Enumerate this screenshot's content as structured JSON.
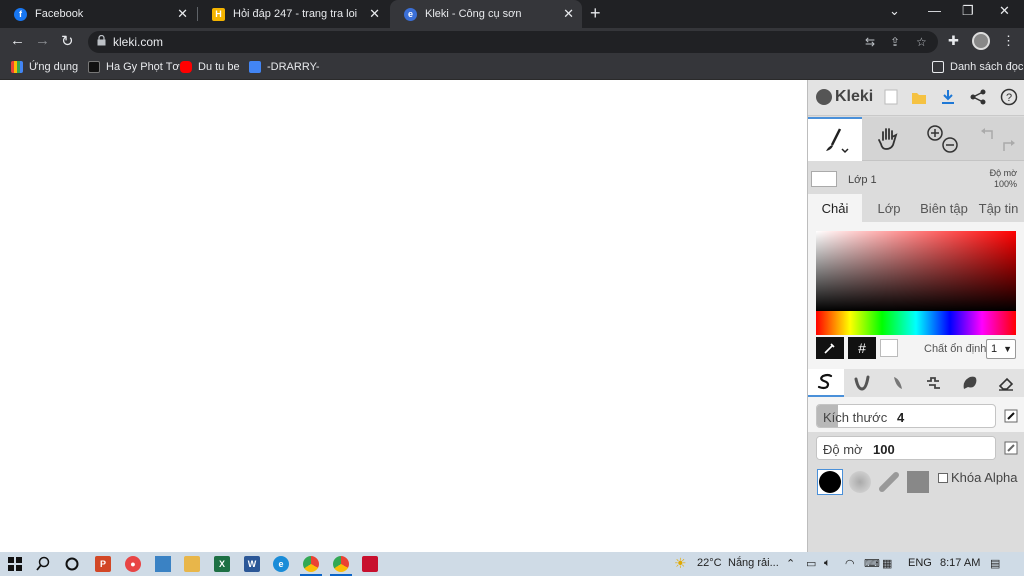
{
  "browser": {
    "tabs": [
      {
        "title": "Facebook",
        "favicon": "facebook-icon",
        "color": "#1877f2"
      },
      {
        "title": "Hỏi đáp 247 - trang tra loi",
        "favicon": "hoidap-icon",
        "color": "#f4b400"
      },
      {
        "title": "Kleki - Công cụ sơn",
        "favicon": "kleki-icon",
        "color": "#3b6fd6"
      }
    ],
    "url": "kleki.com",
    "bookmarks": [
      {
        "label": "Ứng dụng",
        "icon": "apps-grid-icon"
      },
      {
        "label": "Ha Gy Phọt Tơ",
        "icon": "page-icon"
      },
      {
        "label": "Du tu be",
        "icon": "youtube-icon"
      },
      {
        "label": "-DRARRY-",
        "icon": "docs-icon"
      }
    ],
    "reading_list": "Danh sách đọc"
  },
  "kleki": {
    "logo": "Kleki",
    "layer": {
      "name": "Lớp 1",
      "opacity_label": "Độ mờ",
      "opacity_value": "100%"
    },
    "tabs": [
      "Chải",
      "Lớp",
      "Biên tập",
      "Tập tin"
    ],
    "active_tab": "Chải",
    "color": {
      "hex_symbol": "#",
      "stabilizer_label": "Chất ổn định",
      "stabilizer_value": "1"
    },
    "brushes": [
      "pen-brush-icon",
      "blend-brush-icon",
      "sketchy-brush-icon",
      "pixel-brush-icon",
      "chemy-brush-icon",
      "eraser-icon"
    ],
    "size": {
      "label": "Kích thước",
      "value": "4",
      "fraction": 0.12
    },
    "opacity": {
      "label": "Độ mờ",
      "value": "100",
      "fraction": 1.0
    },
    "alpha_lock": "Khóa Alpha"
  },
  "taskbar": {
    "weather": "22°C",
    "weather_text": "Nắng rải...",
    "lang": "ENG",
    "time": "8:17 AM"
  }
}
